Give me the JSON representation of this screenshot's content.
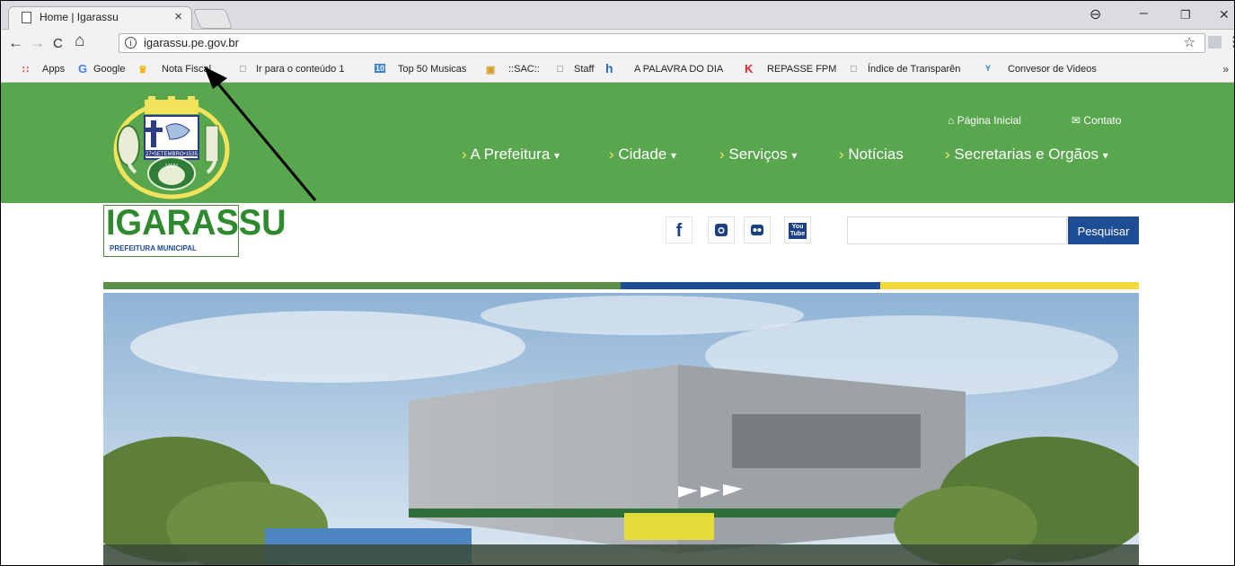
{
  "browser": {
    "tab_title": "Home | Igarassu",
    "tab_close": "×",
    "url": "igarassu.pe.gov.br",
    "controls": {
      "profile": "⊖",
      "minimize": "–",
      "restore": "❐",
      "close": "✕"
    },
    "nav": {
      "back": "←",
      "forward": "→",
      "reload": "C",
      "home": "⌂",
      "star": "☆",
      "menu": "⋮"
    }
  },
  "bookmarks": {
    "items": [
      {
        "label": "Apps",
        "icon": "apps-grid-icon"
      },
      {
        "label": "Google",
        "icon": "google-icon"
      },
      {
        "label": "Nota Fiscal",
        "icon": "crown-icon"
      },
      {
        "label": "Ir para o conteúdo 1",
        "icon": "page-icon"
      },
      {
        "label": "Top 50 Musicas",
        "icon": "top50-icon"
      },
      {
        "label": "::SAC::",
        "icon": "sac-icon"
      },
      {
        "label": "Staff",
        "icon": "page-icon"
      },
      {
        "label": "A PALAVRA DO DIA",
        "icon": "h-logo-icon"
      },
      {
        "label": "REPASSE FPM",
        "icon": "k-logo-icon"
      },
      {
        "label": "Índice de Transparên",
        "icon": "page-icon"
      },
      {
        "label": "Convesor de Videos",
        "icon": "yt-mp3-icon"
      }
    ],
    "more": "»"
  },
  "site": {
    "top_links": {
      "home": "Página Inicial",
      "contact": "Contato"
    },
    "nav": [
      {
        "label": "A Prefeitura",
        "caret": "▾"
      },
      {
        "label": "Cidade",
        "caret": "▾"
      },
      {
        "label": "Serviços",
        "caret": "▾"
      },
      {
        "label": "Notícias",
        "caret": ""
      },
      {
        "label": "Secretarias e Orgãos",
        "caret": "▾"
      }
    ],
    "crest_text": {
      "date": "27•SETEMBRO•1535",
      "name": "VAN"
    },
    "logo": {
      "word": "IGARASSU",
      "sub": "PREFEITURA MUNICIPAL"
    },
    "social": {
      "facebook": "f",
      "youtube_top": "You",
      "youtube_bottom": "Tube"
    },
    "search": {
      "placeholder": "",
      "button": "Pesquisar"
    },
    "colors": {
      "green": "#58a64d",
      "dark_green": "#5a8f47",
      "blue": "#1e4d95",
      "yellow": "#f3d93b"
    }
  }
}
